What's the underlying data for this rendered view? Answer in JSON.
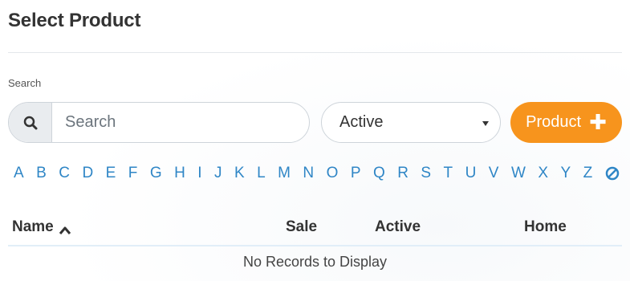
{
  "title": "Select Product",
  "search": {
    "label": "Search",
    "placeholder": "Search",
    "value": ""
  },
  "status_select": {
    "selected": "Active"
  },
  "product_button": {
    "label": "Product"
  },
  "alphabet": [
    "A",
    "B",
    "C",
    "D",
    "E",
    "F",
    "G",
    "H",
    "I",
    "J",
    "K",
    "L",
    "M",
    "N",
    "O",
    "P",
    "Q",
    "R",
    "S",
    "T",
    "U",
    "V",
    "W",
    "X",
    "Y",
    "Z"
  ],
  "table": {
    "columns": {
      "name": "Name",
      "sale": "Sale",
      "active": "Active",
      "home": "Home"
    },
    "empty_message": "No Records to Display"
  },
  "icons": {
    "search": "search-icon",
    "caret": "chevron-down-icon",
    "add": "plus-icon",
    "clear": "clear-filter-icon",
    "sort": "chevron-up-icon"
  },
  "colors": {
    "accent": "#f7941d",
    "link": "#2f86c6",
    "text": "#333333"
  }
}
